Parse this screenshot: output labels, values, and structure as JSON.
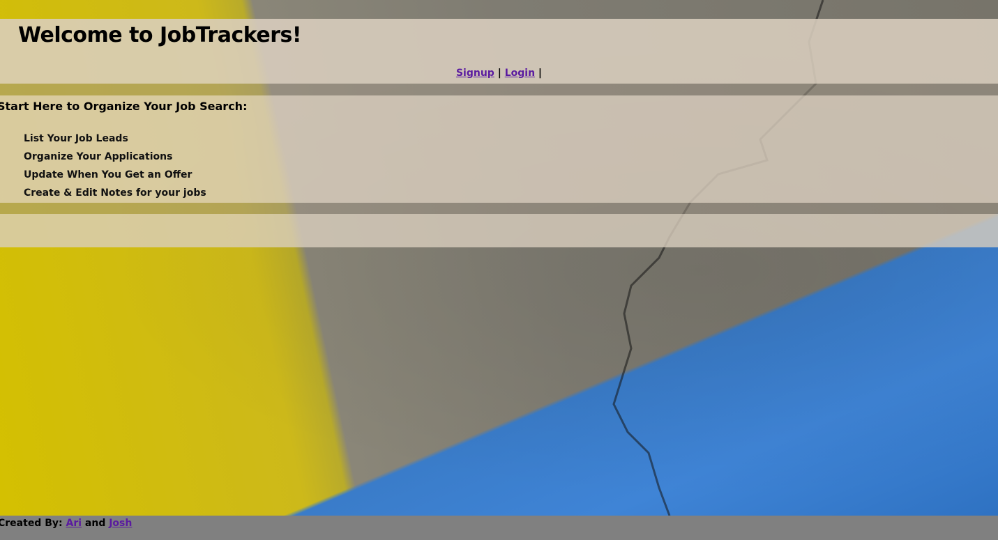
{
  "header": {
    "title": "Welcome to JobTrackers!",
    "nav": {
      "signup_label": "Signup",
      "login_label": "Login",
      "separator": "|"
    }
  },
  "intro": {
    "heading": "Start Here to Organize Your Job Search:",
    "features": [
      "List Your Job Leads",
      "Organize Your Applications",
      "Update When You Get an Offer",
      "Create & Edit Notes for your jobs"
    ]
  },
  "footer": {
    "prefix": "Created By:",
    "author1": "Ari",
    "conjunction": "and",
    "author2": "Josh"
  },
  "colors": {
    "link": "#5a1aa0",
    "footer_bg": "#808080",
    "panel_bg": "#dacebe"
  }
}
